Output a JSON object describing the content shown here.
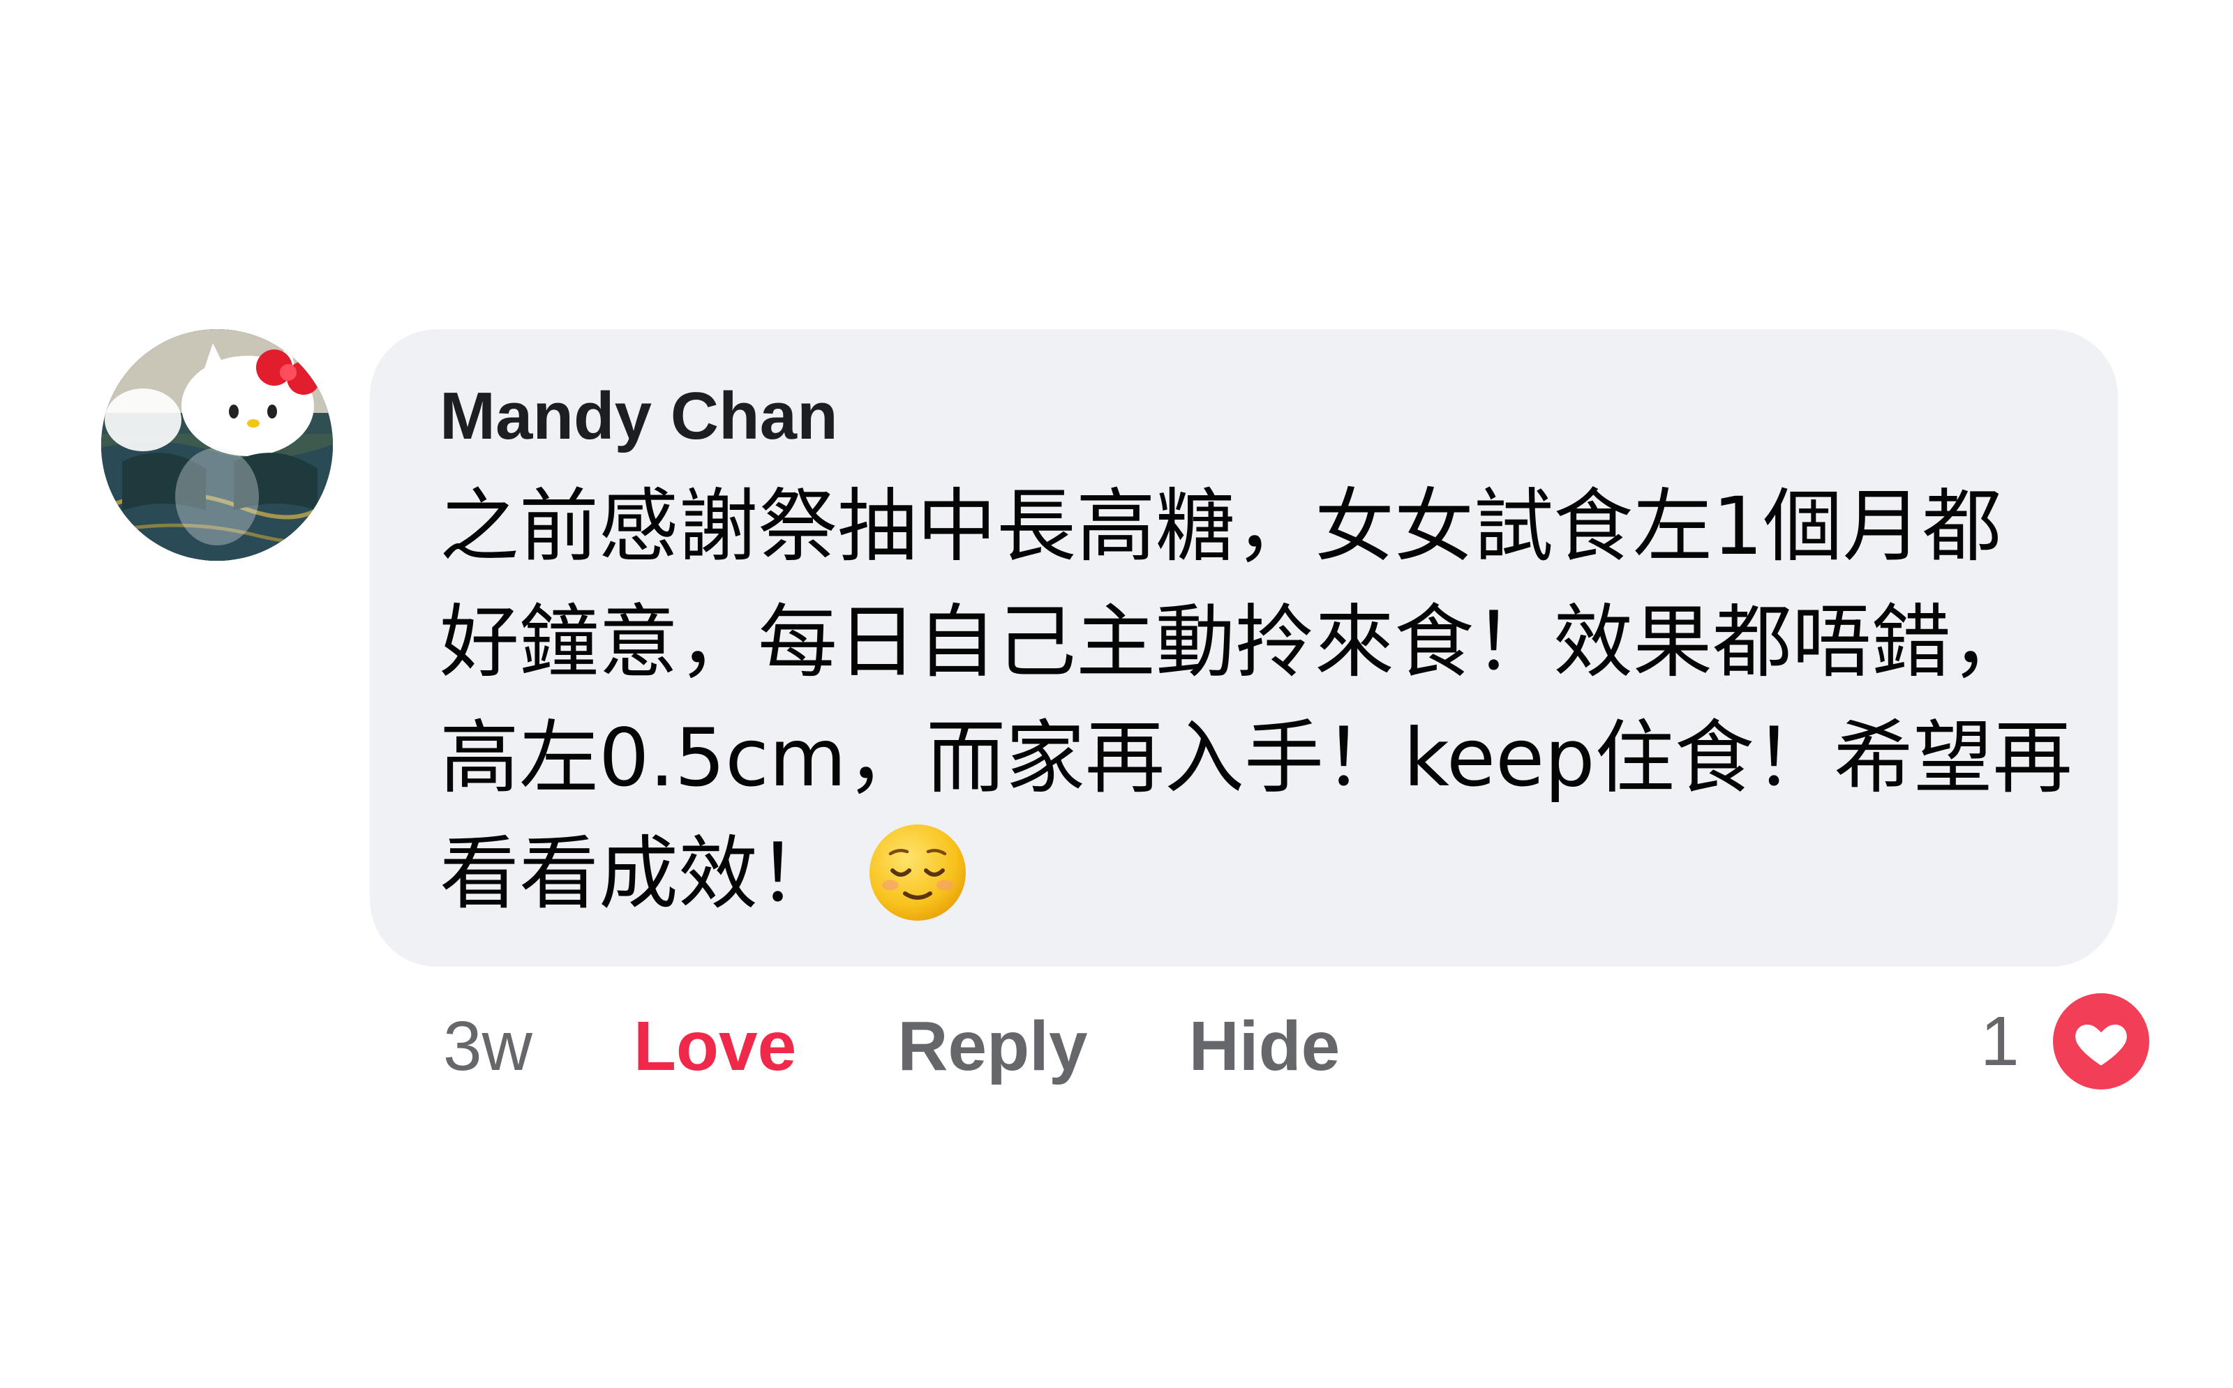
{
  "comment": {
    "author": "Mandy Chan",
    "text": "之前感謝祭抽中長高糖，女女試食左1個月都好鐘意，每日自己主動拎來食！效果都唔錯，高左0.5cm，而家再入手！keep住食！希望再看看成效！",
    "emoji": "relieved-face-emoji",
    "avatar": "hello-kitty-avatar"
  },
  "actions": {
    "timestamp": "3w",
    "love_label": "Love",
    "reply_label": "Reply",
    "hide_label": "Hide"
  },
  "reactions": {
    "count": "1",
    "icon": "heart-icon",
    "color": "#f33e58"
  },
  "colors": {
    "bubble": "#f0f1f5",
    "love_active": "#f0284a",
    "secondary_text": "#65676b"
  }
}
